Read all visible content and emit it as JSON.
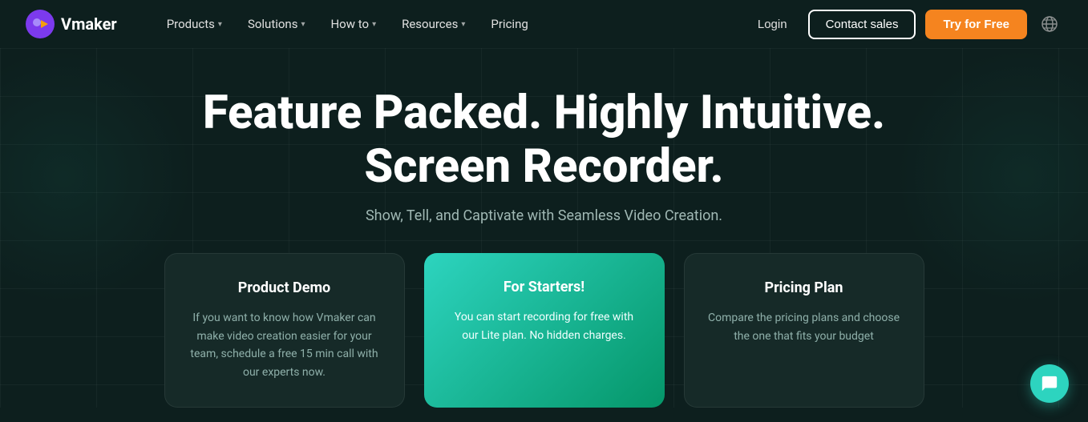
{
  "nav": {
    "logo_text": "Vmaker",
    "links": [
      {
        "id": "products",
        "label": "Products",
        "has_dropdown": true
      },
      {
        "id": "solutions",
        "label": "Solutions",
        "has_dropdown": true
      },
      {
        "id": "how_to",
        "label": "How to",
        "has_dropdown": true
      },
      {
        "id": "resources",
        "label": "Resources",
        "has_dropdown": true
      },
      {
        "id": "pricing",
        "label": "Pricing",
        "has_dropdown": false
      }
    ],
    "login_label": "Login",
    "contact_label": "Contact sales",
    "try_label": "Try for Free"
  },
  "hero": {
    "title_line1": "Feature Packed. Highly Intuitive.",
    "title_line2": "Screen Recorder.",
    "subtitle": "Show, Tell, and Captivate with Seamless Video Creation."
  },
  "cards": [
    {
      "id": "product-demo",
      "title": "Product Demo",
      "body": "If you want to know how Vmaker can make video creation easier for your team, schedule a free 15 min call with our experts now.",
      "featured": false
    },
    {
      "id": "for-starters",
      "title": "For Starters!",
      "body": "You can start recording for free with our Lite plan. No hidden charges.",
      "featured": true
    },
    {
      "id": "pricing-plan",
      "title": "Pricing Plan",
      "body": "Compare the pricing plans and choose the one that fits your budget",
      "featured": false
    }
  ]
}
